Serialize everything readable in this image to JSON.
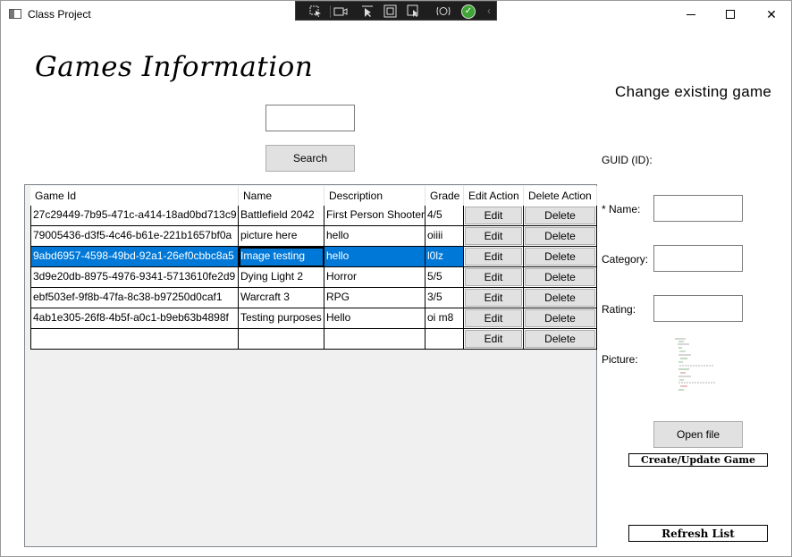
{
  "window": {
    "title": "Class Project",
    "minimize_icon": "minimize-icon",
    "maximize_icon": "maximize-icon",
    "close_icon": "close-icon",
    "close_glyph": "✕"
  },
  "debug_toolbar": {
    "icons": [
      "select-element-icon",
      "camera-icon",
      "pointer-icon",
      "adorner-icon",
      "track-focus-icon",
      "hot-reload-icon",
      "check-icon",
      "collapse-icon"
    ]
  },
  "heading": "Games Information",
  "search": {
    "value": "",
    "button_label": "Search"
  },
  "grid": {
    "columns": [
      "Game Id",
      "Name",
      "Description",
      "Grade",
      "Edit Action",
      "Delete Action"
    ],
    "edit_label": "Edit",
    "delete_label": "Delete",
    "rows": [
      {
        "id": "27c29449-7b95-471c-a414-18ad0bd713c9",
        "name": "Battlefield 2042",
        "description": "First Person Shooter",
        "grade": "4/5"
      },
      {
        "id": "79005436-d3f5-4c46-b61e-221b1657bf0a",
        "name": "picture here",
        "description": "hello",
        "grade": "oiiii"
      },
      {
        "id": "9abd6957-4598-49bd-92a1-26ef0cbbc8a5",
        "name": "Image testing",
        "description": "hello",
        "grade": "l0lz",
        "selected": true
      },
      {
        "id": "3d9e20db-8975-4976-9341-5713610fe2d9",
        "name": "Dying Light 2",
        "description": "Horror",
        "grade": "5/5"
      },
      {
        "id": "ebf503ef-9f8b-47fa-8c38-b97250d0caf1",
        "name": "Warcraft 3",
        "description": "RPG",
        "grade": "3/5"
      },
      {
        "id": "4ab1e305-26f8-4b5f-a0c1-b9eb63b4898f",
        "name": "Testing purposes",
        "description": "Hello",
        "grade": "oi m8"
      },
      {
        "id": "",
        "name": "",
        "description": "",
        "grade": ""
      }
    ],
    "selection_color": "#0078d7"
  },
  "panel": {
    "title": "Change existing game",
    "guid_label": "GUID (ID):",
    "name_label": "* Name:",
    "category_label": "Category:",
    "rating_label": "Rating:",
    "picture_label": "Picture:",
    "name_value": "",
    "category_value": "",
    "rating_value": "",
    "open_file_label": "Open file",
    "create_update_label": "Create/Update Game",
    "refresh_label": "Refresh List"
  }
}
